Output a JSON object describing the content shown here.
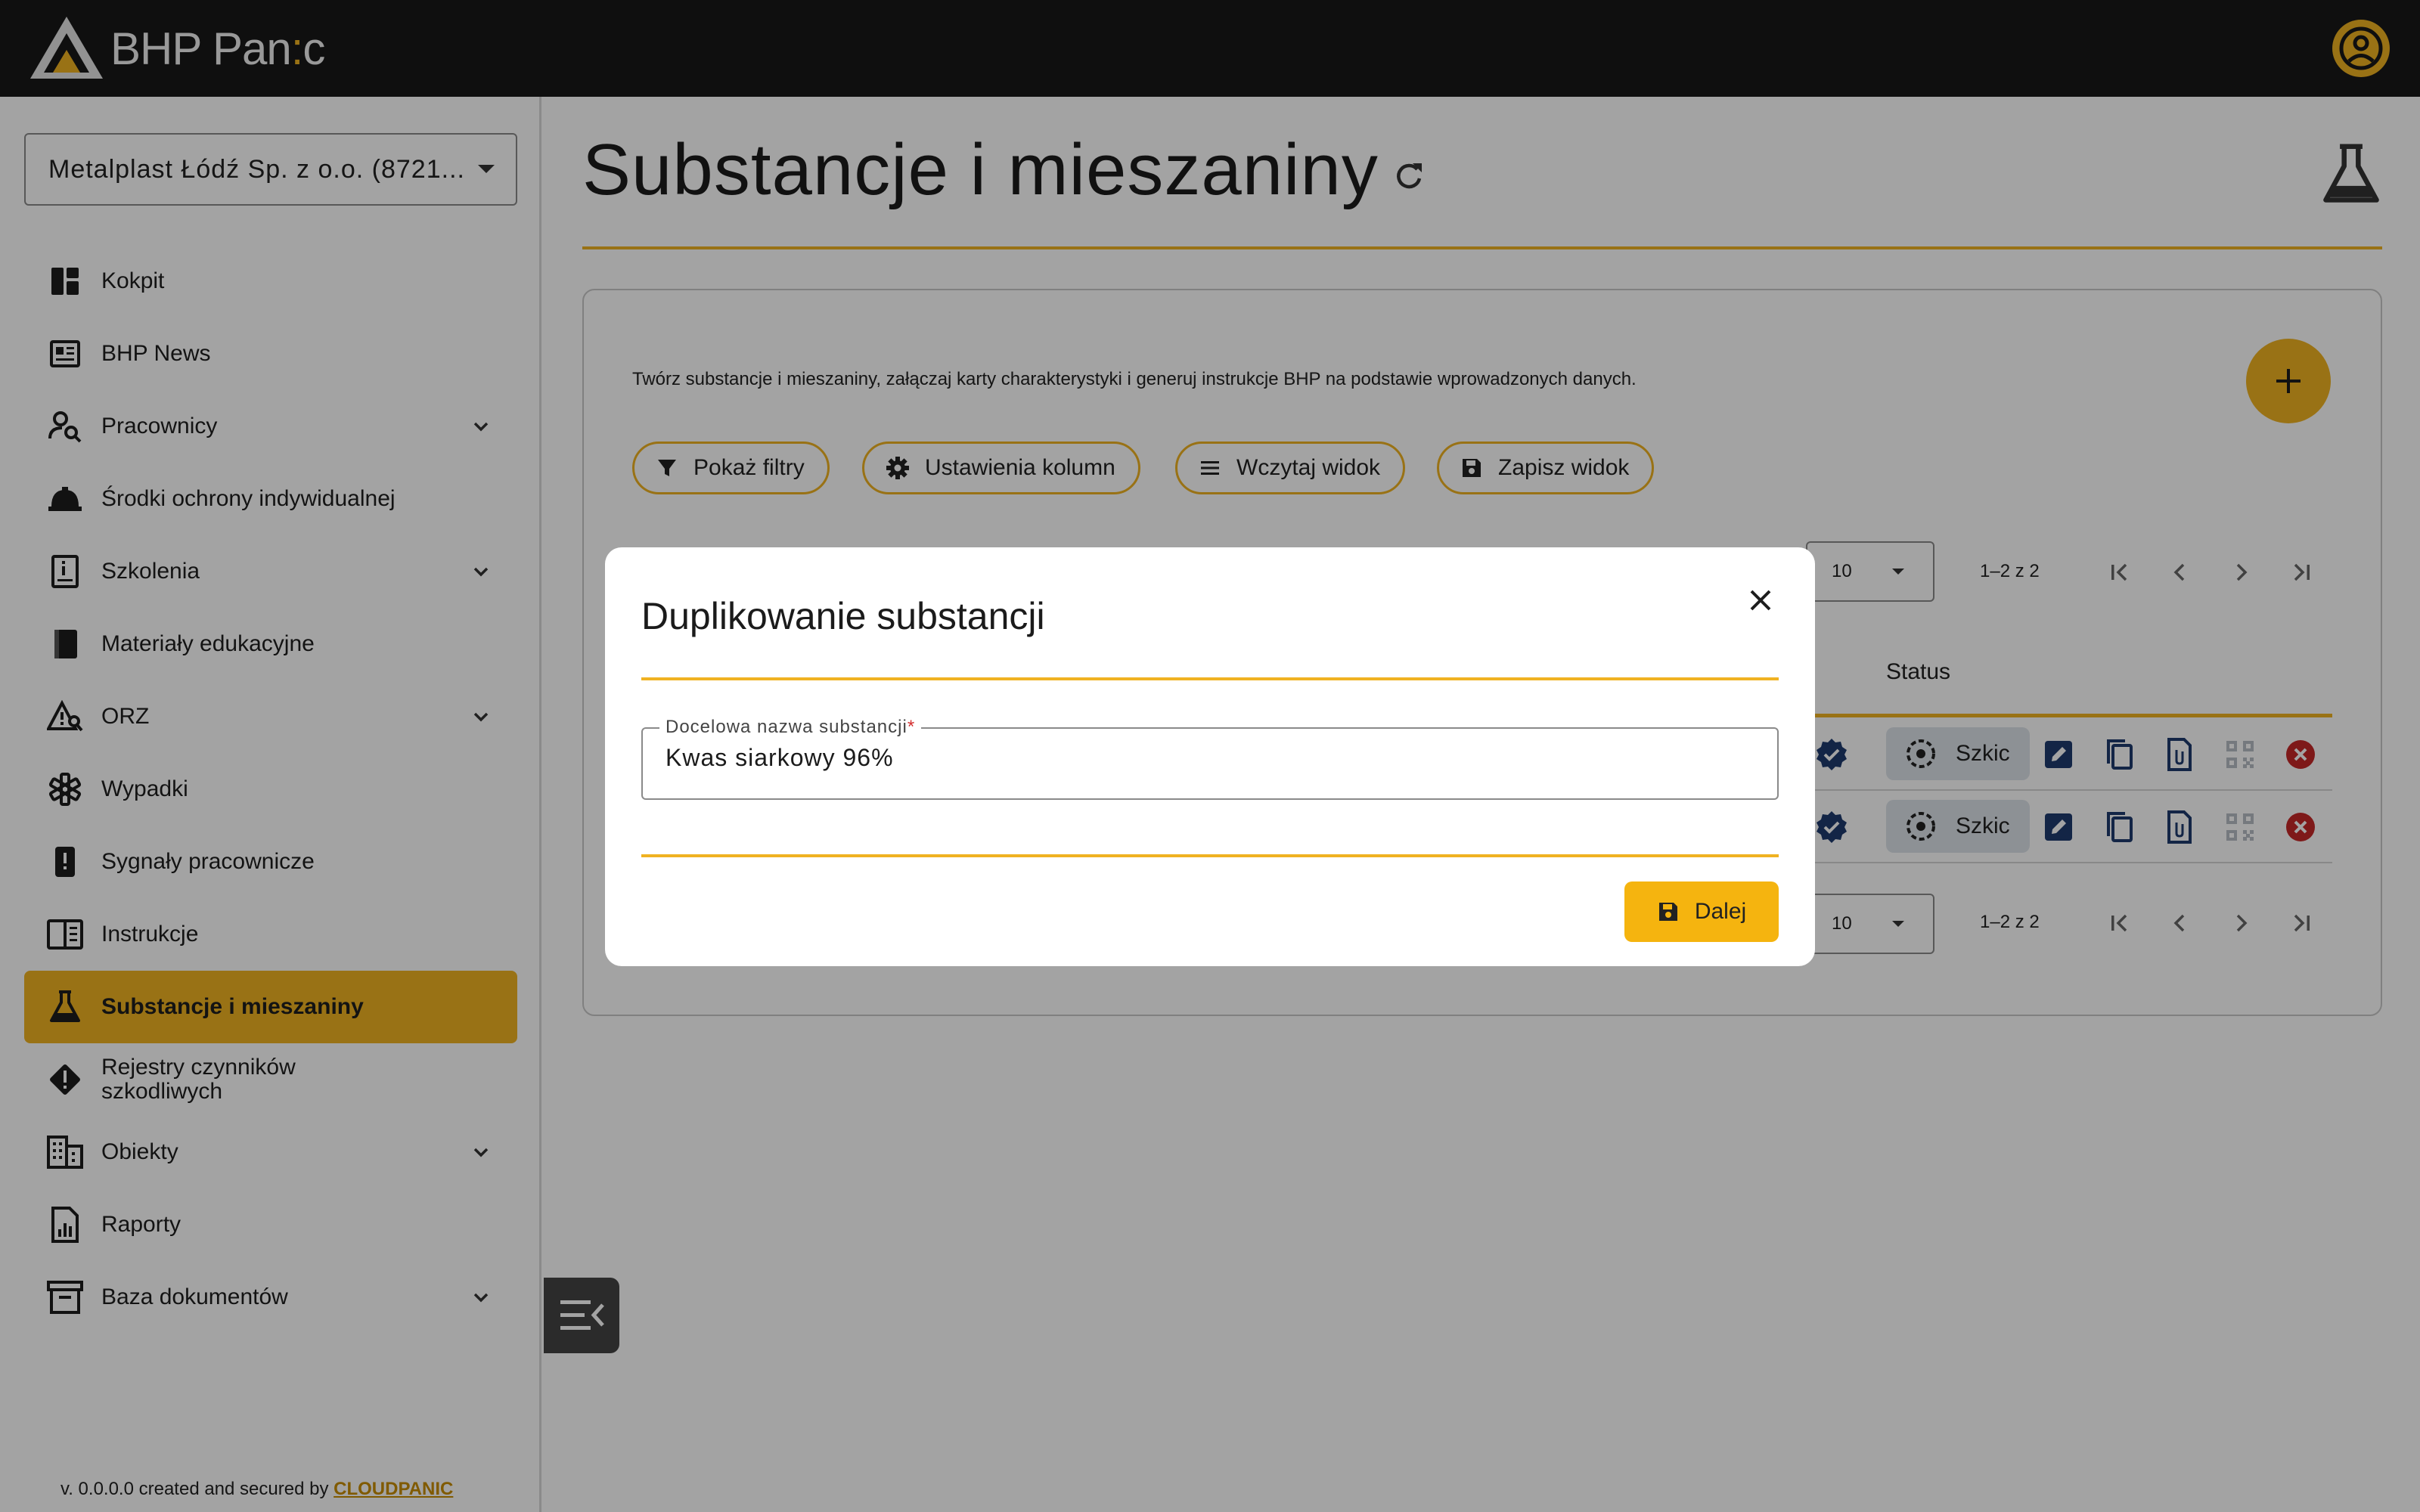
{
  "app": {
    "brand_prefix": "BHP Pan",
    "brand_colon": ":",
    "brand_suffix": "c"
  },
  "sidebar": {
    "company": "Metalplast Łódź Sp. z o.o. (8721...",
    "items": [
      {
        "label": "Kokpit",
        "icon": "dashboard-icon"
      },
      {
        "label": "BHP News",
        "icon": "news-icon"
      },
      {
        "label": "Pracownicy",
        "icon": "person-search-icon",
        "expandable": true
      },
      {
        "label": "Środki ochrony indywidualnej",
        "icon": "helmet-icon"
      },
      {
        "label": "Szkolenia",
        "icon": "training-book-icon",
        "expandable": true
      },
      {
        "label": "Materiały edukacyjne",
        "icon": "book-icon"
      },
      {
        "label": "ORZ",
        "icon": "warning-search-icon",
        "expandable": true
      },
      {
        "label": "Wypadki",
        "icon": "medical-star-icon"
      },
      {
        "label": "Sygnały pracownicze",
        "icon": "alert-phone-icon"
      },
      {
        "label": "Instrukcje",
        "icon": "reader-icon"
      },
      {
        "label": "Substancje i mieszaniny",
        "icon": "flask-icon",
        "active": true
      },
      {
        "label_line1": "Rejestry czynników",
        "label_line2": "szkodliwych",
        "icon": "hazard-icon"
      },
      {
        "label": "Obiekty",
        "icon": "building-icon",
        "expandable": true
      },
      {
        "label": "Raporty",
        "icon": "report-icon"
      },
      {
        "label": "Baza dokumentów",
        "icon": "archive-icon",
        "expandable": true
      }
    ],
    "version_text": "v. 0.0.0.0 created and secured by ",
    "version_link": "CLOUDPANIC"
  },
  "main": {
    "title": "Substancje i mieszaniny",
    "description": "Twórz substancje i mieszaniny, załączaj karty charakterystyki i generuj instrukcje BHP na podstawie wprowadzonych danych.",
    "toolbar": {
      "filters": "Pokaż filtry",
      "columns": "Ustawienia kolumn",
      "load_view": "Wczytaj widok",
      "save_view": "Zapisz widok"
    },
    "pager": {
      "page_size": "10",
      "range": "1–2 z 2"
    },
    "table": {
      "status_header": "Status",
      "rows": [
        {
          "status": "Szkic"
        },
        {
          "status": "Szkic"
        }
      ]
    }
  },
  "dialog": {
    "title": "Duplikowanie substancji",
    "field_label": "Docelowa nazwa substancji",
    "field_required": "*",
    "field_value": "Kwas siarkowy 96%",
    "submit": "Dalej"
  },
  "colors": {
    "accent": "#f0b221",
    "topbar": "#181818",
    "icon_blue": "#1e3a6e",
    "danger": "#c62828"
  }
}
